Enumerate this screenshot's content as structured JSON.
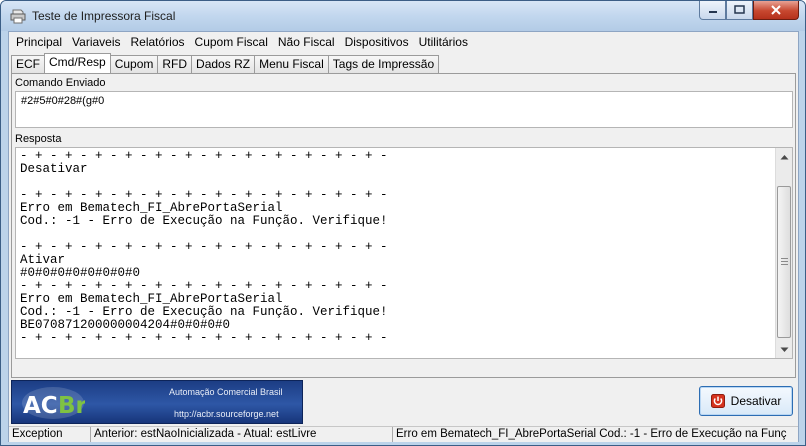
{
  "window": {
    "title": "Teste de Impressora Fiscal"
  },
  "menu": [
    "Principal",
    "Variaveis",
    "Relatórios",
    "Cupom Fiscal",
    "Não Fiscal",
    "Dispositivos",
    "Utilitários"
  ],
  "tabs": [
    "ECF",
    "Cmd/Resp",
    "Cupom",
    "RFD",
    "Dados RZ",
    "Menu Fiscal",
    "Tags de Impressão"
  ],
  "active_tab": "Cmd/Resp",
  "comando": {
    "label": "Comando Enviado",
    "value": "#2#5#0#28#(g#0"
  },
  "resposta": {
    "label": "Resposta",
    "lines": [
      "- + - + - + - + - + - + - + - + - + - + - + - + -",
      "Desativar",
      "",
      "- + - + - + - + - + - + - + - + - + - + - + - + -",
      "Erro em Bematech_FI_AbrePortaSerial",
      "Cod.: -1 - Erro de Execução na Função. Verifique!",
      "",
      "- + - + - + - + - + - + - + - + - + - + - + - + -",
      "Ativar",
      "#0#0#0#0#0#0#0#0",
      "- + - + - + - + - + - + - + - + - + - + - + - + -",
      "Erro em Bematech_FI_AbrePortaSerial",
      "Cod.: -1 - Erro de Execução na Função. Verifique!",
      "BE070871200000004204#0#0#0#0",
      "- + - + - + - + - + - + - + - + - + - + - + - + -"
    ]
  },
  "banner": {
    "logo_text": "ACBr",
    "subtitle": "Automação Comercial Brasil",
    "url": "http://acbr.sourceforge.net"
  },
  "button": {
    "label": "Desativar",
    "icon": "power-icon"
  },
  "status": {
    "p1": "Exception",
    "p2": "Anterior: estNaoInicializada - Atual: estLivre",
    "p3": "Erro em Bematech_FI_AbrePortaSerial  Cod.: -1 - Erro de Execução na Funç"
  },
  "colors": {
    "accent": "#2e57a6",
    "close": "#c7472f"
  }
}
